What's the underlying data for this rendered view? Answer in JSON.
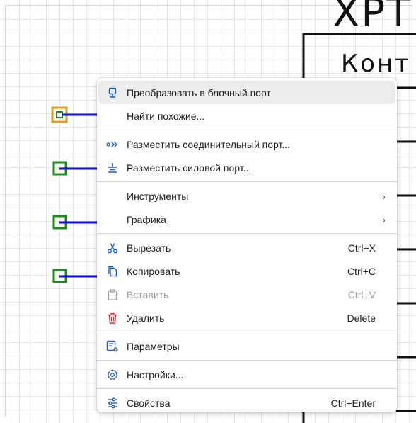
{
  "diagram": {
    "block_title": "ХРТ",
    "block_subtitle": "Конт",
    "ports": [
      {
        "kind": "selected",
        "color": "#e0a020"
      },
      {
        "kind": "normal",
        "color": "#1a8c1a"
      },
      {
        "kind": "normal",
        "color": "#1a8c1a"
      },
      {
        "kind": "normal",
        "color": "#1a8c1a"
      }
    ],
    "wire_color": "#1010e0"
  },
  "menu": {
    "items": [
      {
        "id": "convert",
        "label": "Преобразовать в блочный порт",
        "icon": "block-port-icon",
        "shortcut": "",
        "hover": true
      },
      {
        "id": "find",
        "label": "Найти похожие...",
        "icon": "",
        "shortcut": ""
      },
      {
        "id": "place-connect",
        "label": "Разместить соединительный порт...",
        "icon": "connection-port-icon",
        "shortcut": ""
      },
      {
        "id": "place-power",
        "label": "Разместить силовой порт...",
        "icon": "power-port-icon",
        "shortcut": ""
      },
      {
        "id": "tools",
        "label": "Инструменты",
        "icon": "",
        "shortcut": "",
        "arrow": "›"
      },
      {
        "id": "graphics",
        "label": "Графика",
        "icon": "",
        "shortcut": "",
        "arrow": "›"
      },
      {
        "id": "cut",
        "label": "Вырезать",
        "icon": "scissors-icon",
        "shortcut": "Ctrl+X"
      },
      {
        "id": "copy",
        "label": "Копировать",
        "icon": "copy-icon",
        "shortcut": "Ctrl+C"
      },
      {
        "id": "paste",
        "label": "Вставить",
        "icon": "clipboard-icon",
        "shortcut": "Ctrl+V",
        "disabled": true
      },
      {
        "id": "delete",
        "label": "Удалить",
        "icon": "trash-icon",
        "shortcut": "Delete"
      },
      {
        "id": "params",
        "label": "Параметры",
        "icon": "parameters-icon",
        "shortcut": ""
      },
      {
        "id": "settings",
        "label": "Настройки...",
        "icon": "gear-icon",
        "shortcut": ""
      },
      {
        "id": "props",
        "label": "Свойства",
        "icon": "sliders-icon",
        "shortcut": "Ctrl+Enter"
      }
    ]
  }
}
